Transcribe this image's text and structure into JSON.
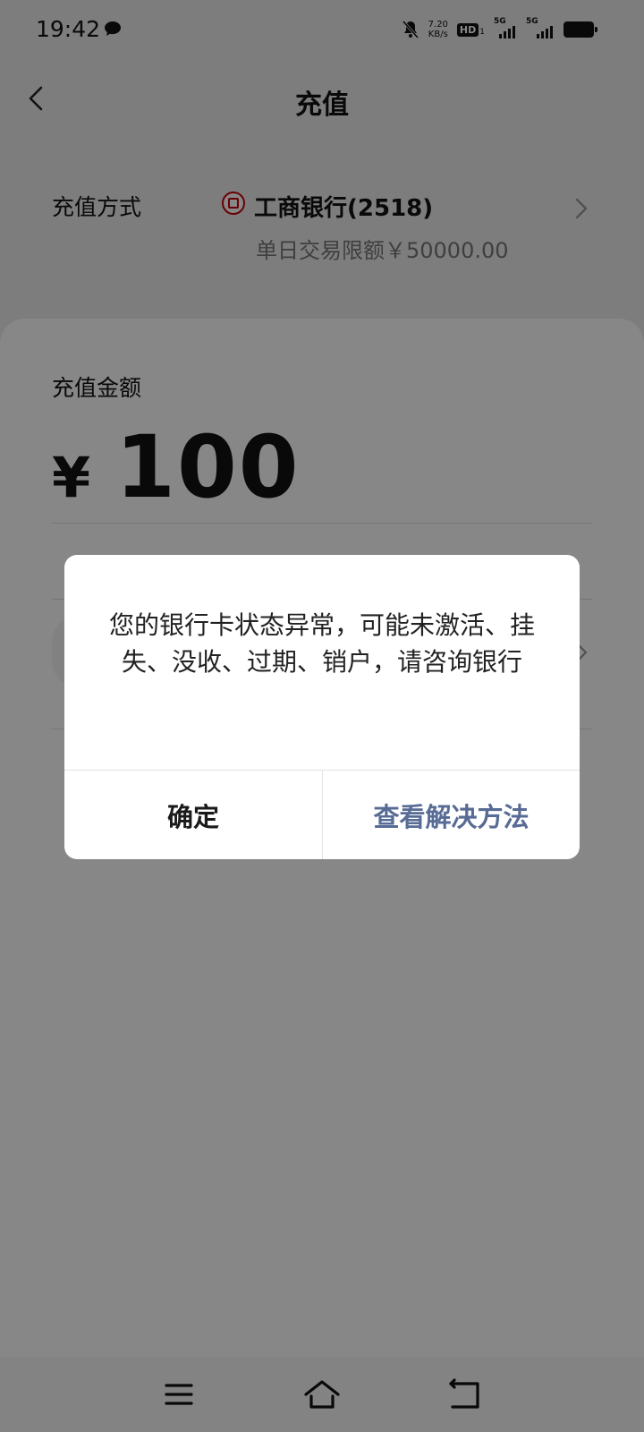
{
  "status_bar": {
    "time": "19:42",
    "net_speed_value": "7.20",
    "net_speed_unit": "KB/s",
    "hd_label": "HD",
    "hd_sub": "1",
    "sim1_label": "5G",
    "sim2_label": "5G",
    "icons": [
      "chat-bubble-icon",
      "mute-bell-icon",
      "signal-icon",
      "battery-icon"
    ]
  },
  "header": {
    "title": "充值"
  },
  "payment_method": {
    "label": "充值方式",
    "bank_name": "工商银行(2518)",
    "limit_text": "单日交易限额￥50000.00",
    "bank_color": "#c7000b"
  },
  "amount": {
    "label": "充值金额",
    "currency": "¥",
    "value": "100"
  },
  "dialog": {
    "message": "您的银行卡状态异常，可能未激活、挂失、没收、过期、销户，请咨询银行",
    "confirm_label": "确定",
    "solution_label": "查看解决方法",
    "solution_color": "#576b95"
  },
  "nav": {
    "icons": [
      "menu-icon",
      "home-icon",
      "back-icon"
    ]
  }
}
